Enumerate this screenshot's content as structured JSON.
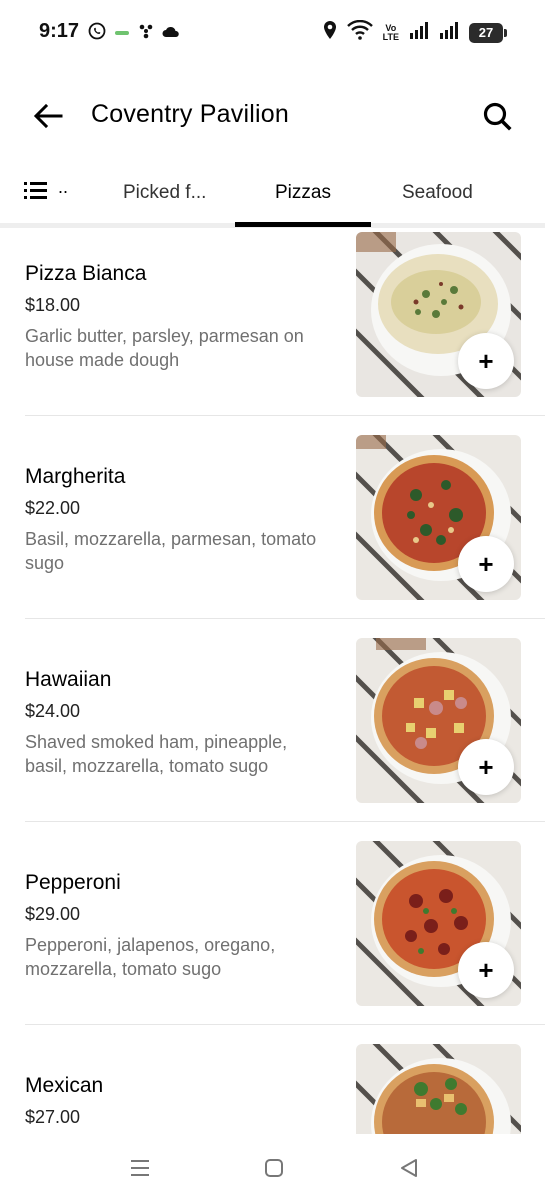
{
  "status_bar": {
    "time": "9:17",
    "left_icons": [
      "whatsapp-icon",
      "app-notification-icon",
      "fan-icon",
      "cloud-icon"
    ],
    "right_icons": [
      "location-icon",
      "wifi-icon",
      "volte-icon",
      "signal-icon",
      "signal-icon",
      "battery-icon"
    ],
    "volte_text_line1": "Vo",
    "volte_text_line2": "LTE",
    "battery_level": "27"
  },
  "header": {
    "title": "Coventry Pavilion",
    "back_icon": "back-arrow-icon",
    "search_icon": "search-icon"
  },
  "tabs": {
    "menu_icon": "list-icon",
    "menu_ellipsis": "..",
    "items": [
      {
        "label": "Picked f..."
      },
      {
        "label": "Pizzas"
      },
      {
        "label": "Seafood"
      }
    ],
    "active_index": 1
  },
  "menu": {
    "add_label": "+",
    "items": [
      {
        "name": "Pizza Bianca",
        "price": "$18.00",
        "description": "Garlic butter, parsley, parmesan on house made dough",
        "photo": "pizza-bianca"
      },
      {
        "name": "Margherita",
        "price": "$22.00",
        "description": "Basil, mozzarella, parmesan, tomato sugo",
        "photo": "margherita"
      },
      {
        "name": "Hawaiian",
        "price": "$24.00",
        "description": "Shaved smoked ham, pineapple, basil, mozzarella, tomato sugo",
        "photo": "hawaiian"
      },
      {
        "name": "Pepperoni",
        "price": "$29.00",
        "description": "Pepperoni, jalapenos, oregano, mozzarella, tomato sugo",
        "photo": "pepperoni"
      },
      {
        "name": "Mexican",
        "price": "$27.00",
        "description": "",
        "photo": "mexican"
      }
    ]
  },
  "nav_bar": {
    "icons": [
      "recents-icon",
      "home-icon",
      "back-icon"
    ]
  },
  "colors": {
    "text_primary": "#000000",
    "text_secondary": "#707070",
    "tab_underline": "#000000",
    "divider": "#e6e6e6"
  }
}
